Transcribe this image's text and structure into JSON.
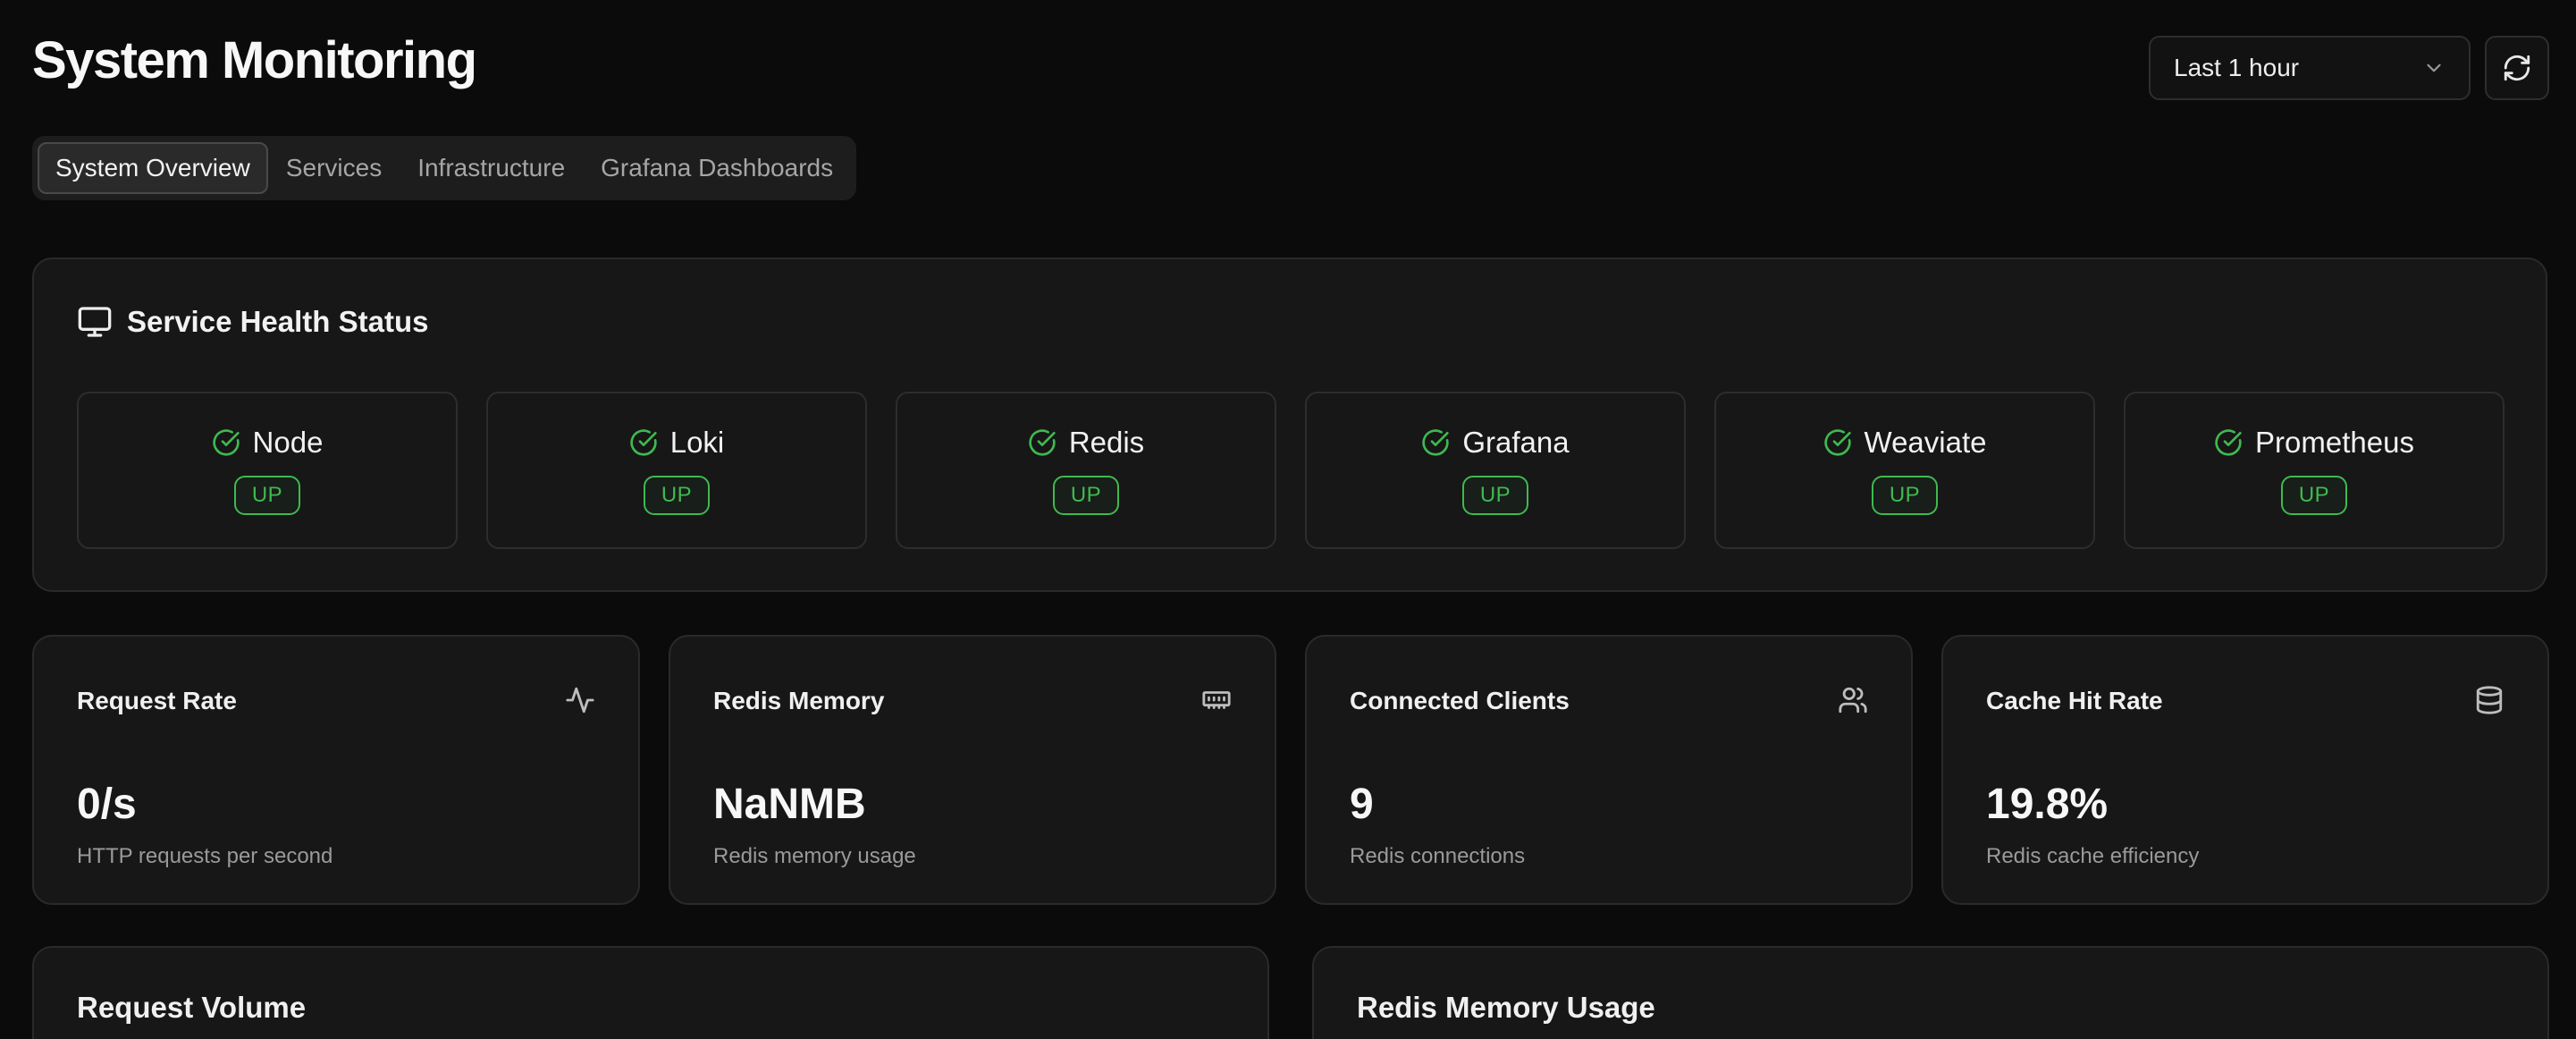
{
  "header": {
    "title": "System Monitoring",
    "time_range": "Last 1 hour"
  },
  "tabs": [
    {
      "label": "System Overview",
      "active": true
    },
    {
      "label": "Services",
      "active": false
    },
    {
      "label": "Infrastructure",
      "active": false
    },
    {
      "label": "Grafana Dashboards",
      "active": false
    }
  ],
  "health": {
    "title": "Service Health Status",
    "services": [
      {
        "name": "Node",
        "status": "UP"
      },
      {
        "name": "Loki",
        "status": "UP"
      },
      {
        "name": "Redis",
        "status": "UP"
      },
      {
        "name": "Grafana",
        "status": "UP"
      },
      {
        "name": "Weaviate",
        "status": "UP"
      },
      {
        "name": "Prometheus",
        "status": "UP"
      }
    ]
  },
  "metrics": [
    {
      "title": "Request Rate",
      "value": "0/s",
      "description": "HTTP requests per second",
      "icon": "activity-icon"
    },
    {
      "title": "Redis Memory",
      "value": "NaNMB",
      "description": "Redis memory usage",
      "icon": "memory-icon"
    },
    {
      "title": "Connected Clients",
      "value": "9",
      "description": "Redis connections",
      "icon": "users-icon"
    },
    {
      "title": "Cache Hit Rate",
      "value": "19.8%",
      "description": "Redis cache efficiency",
      "icon": "database-icon"
    }
  ],
  "charts": [
    {
      "title": "Request Volume"
    },
    {
      "title": "Redis Memory Usage"
    }
  ],
  "colors": {
    "background": "#0b0b0b",
    "card": "#171717",
    "status_up": "#3fb950"
  }
}
